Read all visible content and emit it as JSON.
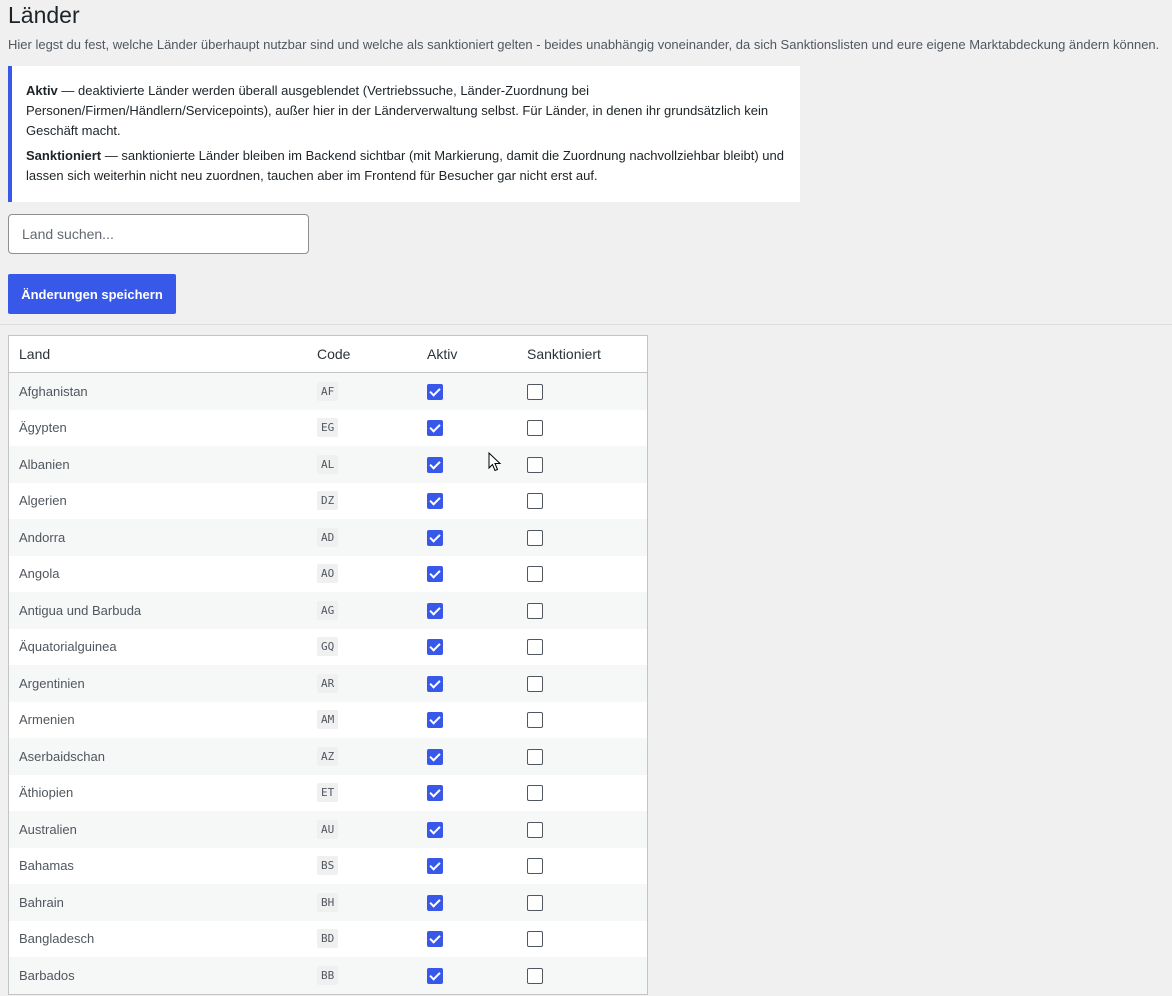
{
  "page": {
    "title": "Länder",
    "description": "Hier legst du fest, welche Länder überhaupt nutzbar sind und welche als sanktioniert gelten - beides unabhängig voneinander, da sich Sanktionslisten und eure eigene Marktabdeckung ändern können."
  },
  "notice": {
    "aktiv_label": "Aktiv",
    "aktiv_text": " — deaktivierte Länder werden überall ausgeblendet (Vertriebssuche, Länder-Zuordnung bei Personen/Firmen/Händlern/Servicepoints), außer hier in der Länderverwaltung selbst. Für Länder, in denen ihr grundsätzlich kein Geschäft macht.",
    "sanktioniert_label": "Sanktioniert",
    "sanktioniert_text": " — sanktionierte Länder bleiben im Backend sichtbar (mit Markierung, damit die Zuordnung nachvollziehbar bleibt) und lassen sich weiterhin nicht neu zuordnen, tauchen aber im Frontend für Besucher gar nicht erst auf."
  },
  "search": {
    "placeholder": "Land suchen..."
  },
  "toolbar": {
    "save_label": "Änderungen speichern"
  },
  "colors": {
    "accent": "#3858e9",
    "page_bg": "#f0f0f1"
  },
  "table": {
    "headers": {
      "land": "Land",
      "code": "Code",
      "aktiv": "Aktiv",
      "sanktioniert": "Sanktioniert"
    },
    "rows": [
      {
        "name": "Afghanistan",
        "code": "AF",
        "aktiv": true,
        "sanktioniert": false
      },
      {
        "name": "Ägypten",
        "code": "EG",
        "aktiv": true,
        "sanktioniert": false
      },
      {
        "name": "Albanien",
        "code": "AL",
        "aktiv": true,
        "sanktioniert": false
      },
      {
        "name": "Algerien",
        "code": "DZ",
        "aktiv": true,
        "sanktioniert": false
      },
      {
        "name": "Andorra",
        "code": "AD",
        "aktiv": true,
        "sanktioniert": false
      },
      {
        "name": "Angola",
        "code": "AO",
        "aktiv": true,
        "sanktioniert": false
      },
      {
        "name": "Antigua und Barbuda",
        "code": "AG",
        "aktiv": true,
        "sanktioniert": false
      },
      {
        "name": "Äquatorialguinea",
        "code": "GQ",
        "aktiv": true,
        "sanktioniert": false
      },
      {
        "name": "Argentinien",
        "code": "AR",
        "aktiv": true,
        "sanktioniert": false
      },
      {
        "name": "Armenien",
        "code": "AM",
        "aktiv": true,
        "sanktioniert": false
      },
      {
        "name": "Aserbaidschan",
        "code": "AZ",
        "aktiv": true,
        "sanktioniert": false
      },
      {
        "name": "Äthiopien",
        "code": "ET",
        "aktiv": true,
        "sanktioniert": false
      },
      {
        "name": "Australien",
        "code": "AU",
        "aktiv": true,
        "sanktioniert": false
      },
      {
        "name": "Bahamas",
        "code": "BS",
        "aktiv": true,
        "sanktioniert": false
      },
      {
        "name": "Bahrain",
        "code": "BH",
        "aktiv": true,
        "sanktioniert": false
      },
      {
        "name": "Bangladesch",
        "code": "BD",
        "aktiv": true,
        "sanktioniert": false
      },
      {
        "name": "Barbados",
        "code": "BB",
        "aktiv": true,
        "sanktioniert": false
      }
    ]
  }
}
